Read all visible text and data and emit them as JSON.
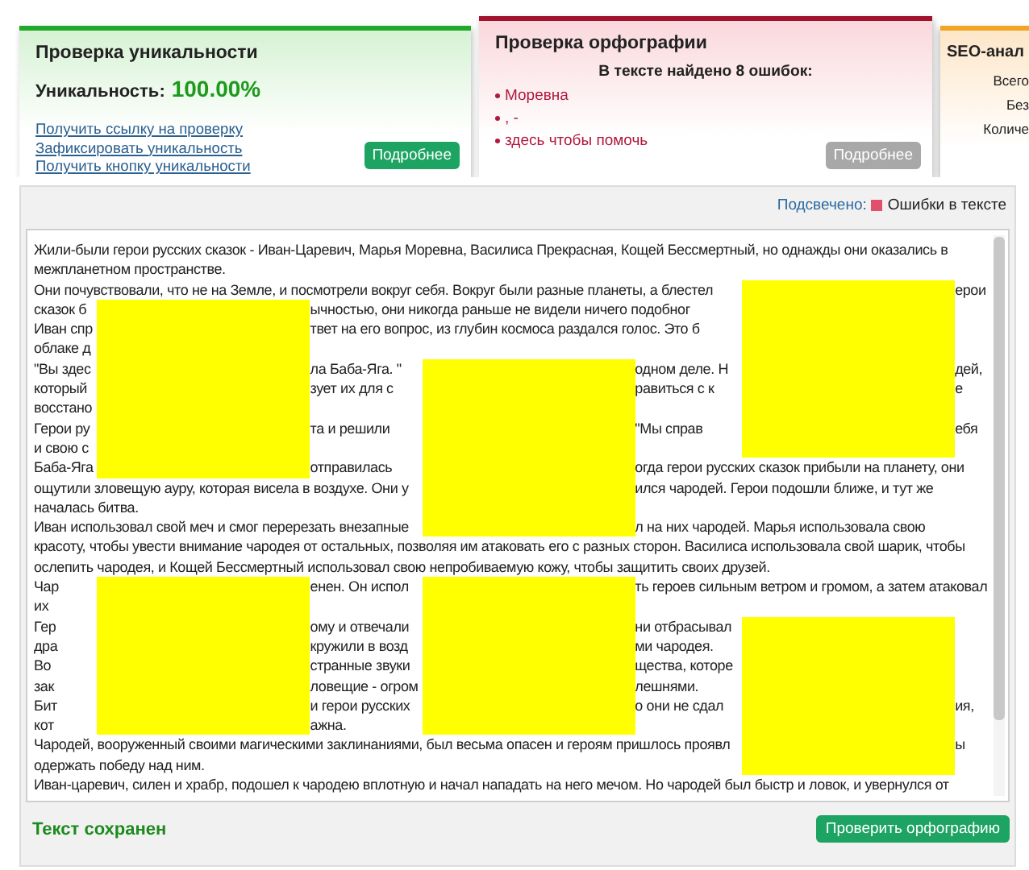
{
  "uniqueness_card": {
    "title": "Проверка уникальности",
    "label": "Уникальность:",
    "value": "100.00%",
    "links": [
      "Получить ссылку на проверку",
      "Зафиксировать уникальность",
      "Получить кнопку уникальности"
    ],
    "button": "Подробнее",
    "button_disabled": false
  },
  "spelling_card": {
    "title": "Проверка орфографии",
    "summary": "В тексте найдено 8 ошибок:",
    "errors": [
      "Моревна",
      ", -",
      "здесь чтобы помочь"
    ],
    "button": "Подробнее",
    "button_disabled": true
  },
  "seo_card": {
    "title": "SEO-анал",
    "rows": [
      "Всего",
      "Без",
      "Количе"
    ]
  },
  "editor": {
    "highlight_label": "Подсвечено:",
    "legend": [
      {
        "label": "Ошибки в тексте",
        "color": "#e0506a"
      }
    ],
    "lines": [
      {
        "start": "Жили-были герои русских сказок - Иван-Царевич, Марья Моревна, Василиса Прекрасная, Кощей Бессмертный, но однажды они оказались в"
      },
      {
        "start": "межпланетном пространстве."
      },
      {
        "start": "Они почувствовали, что не на Земле, и посмотрели вокруг себя. Вокруг были разные планеты, а блестел",
        "after_right": "ерои"
      },
      {
        "start": "сказок б",
        "after_left": "ычностью, они никогда раньше не видели ничего подобног"
      },
      {
        "start": "Иван спр",
        "after_left": "твет на его вопрос, из глубин космоса раздался голос. Это б"
      },
      {
        "start": "облаке д"
      },
      {
        "start": "\"Вы здес",
        "after_left": "ла Баба-Яга. \"",
        "after_middle": "одном деле. Н",
        "after_right": "дей,"
      },
      {
        "start": "который",
        "after_left": "зует их для с",
        "after_middle": "равиться с к",
        "after_right": "е"
      },
      {
        "start": "восстано"
      },
      {
        "start": "Герои ру",
        "after_left": "та и решили",
        "after_middle": "\"Мы справ",
        "after_right": "ебя"
      },
      {
        "start": "и свою с"
      },
      {
        "start": "Баба-Яга",
        "after_left": "отправилась",
        "after_middle": "огда герои русских сказок прибыли на планету, они"
      },
      {
        "start": "ощутили зловещую ауру, которая висела в воздухе. Они у",
        "after_middle": "ился чародей. Герои подошли ближе, и тут же"
      },
      {
        "start": "началась битва."
      },
      {
        "start": "Иван использовал свой меч и смог перерезать внезапные",
        "after_middle": "л на них чародей. Марья использовала свою"
      },
      {
        "start": "красоту, чтобы увести внимание чародея от остальных, позволяя им атаковать его с разных сторон. Василиса использовала свой шарик, чтобы"
      },
      {
        "start": "ослепить чародея, и Кощей Бессмертный использовал свою непробиваемую кожу, чтобы защитить своих друзей."
      },
      {
        "start": "Чар",
        "after_left": "енен. Он испол",
        "after_middle": "ть героев сильным ветром и громом, а затем атаковал"
      },
      {
        "start": "их"
      },
      {
        "start": "Гер",
        "after_left": "ому и отвечали",
        "after_middle": "ни отбрасывал"
      },
      {
        "start": "дра",
        "after_left": "кружили в возд",
        "after_middle": "ми чародея."
      },
      {
        "start": "Во",
        "after_left": "странные звуки",
        "after_middle": "щества, которе"
      },
      {
        "start": "зак",
        "after_left": "ловещие - огром",
        "after_middle": "лешнями."
      },
      {
        "start": "Бит",
        "after_left": "и герои русских",
        "after_middle": "о они не сдал",
        "after_right": "ия,"
      },
      {
        "start": "кот",
        "after_left": "ажна."
      },
      {
        "start": "Чародей, вооруженный своими магическими заклинаниями, был весьма опасен и героям пришлось проявл",
        "after_right": "ы"
      },
      {
        "start": "одержать победу над ним."
      },
      {
        "start": "Иван-царевич, силен и храбр, подошел к чародею вплотную и начал нападать на него мечом. Но чародей был быстр и ловок, и увернулся от"
      }
    ],
    "status": "Текст сохранен",
    "button": "Проверить орфографию"
  }
}
